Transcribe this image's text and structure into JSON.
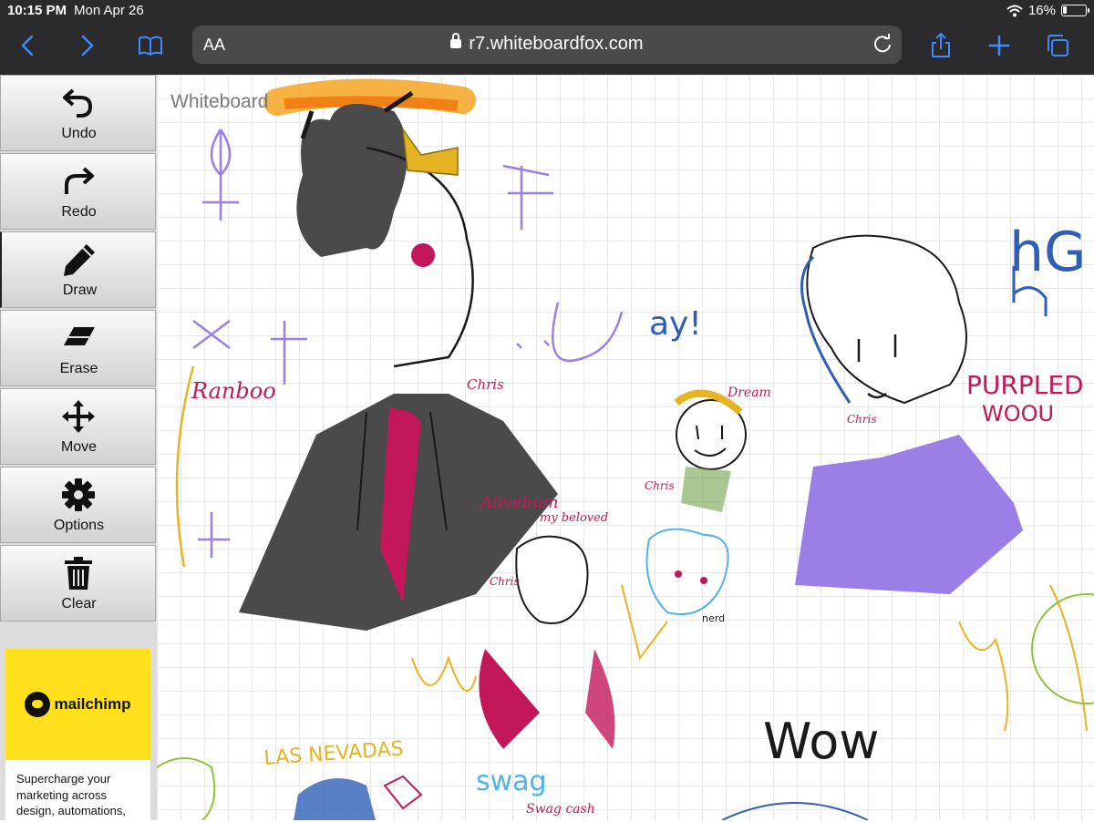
{
  "status_bar": {
    "time": "10:15 PM",
    "date": "Mon Apr 26",
    "battery_percent": "16%",
    "battery_level": 0.16
  },
  "browser": {
    "text_size_label": "AA",
    "url": "r7.whiteboardfox.com",
    "icons": [
      "back-icon",
      "forward-icon",
      "bookmarks-icon",
      "lock-icon",
      "reload-icon",
      "share-icon",
      "new-tab-icon",
      "tabs-icon"
    ]
  },
  "toolbar": {
    "tools": [
      {
        "label": "Undo",
        "icon": "undo-icon"
      },
      {
        "label": "Redo",
        "icon": "redo-icon"
      },
      {
        "label": "Draw",
        "icon": "pencil-icon",
        "active": true
      },
      {
        "label": "Erase",
        "icon": "eraser-icon"
      },
      {
        "label": "Move",
        "icon": "move-icon"
      },
      {
        "label": "Options",
        "icon": "gear-icon"
      },
      {
        "label": "Clear",
        "icon": "trash-icon"
      }
    ]
  },
  "ad": {
    "brand": "mailchimp",
    "text": "Supercharge your marketing across design, automations,"
  },
  "canvas": {
    "title": "Whiteboard",
    "handwriting": [
      "Ranboo",
      "Chris",
      "Alivebum",
      "my beloved",
      "Dream",
      "PURPLED",
      "WOOU",
      "LAS NEVADAS",
      "swag",
      "Swag cash",
      "Wow",
      "hG",
      "nerd",
      "ay!"
    ],
    "colors": {
      "ink_black": "#1a1a1a",
      "magenta": "#c2185b",
      "purple": "#9b7fe6",
      "blue": "#2f5fb5",
      "gold": "#e6b422",
      "cyan": "#4fb3e8",
      "orange": "#f5a623"
    }
  }
}
